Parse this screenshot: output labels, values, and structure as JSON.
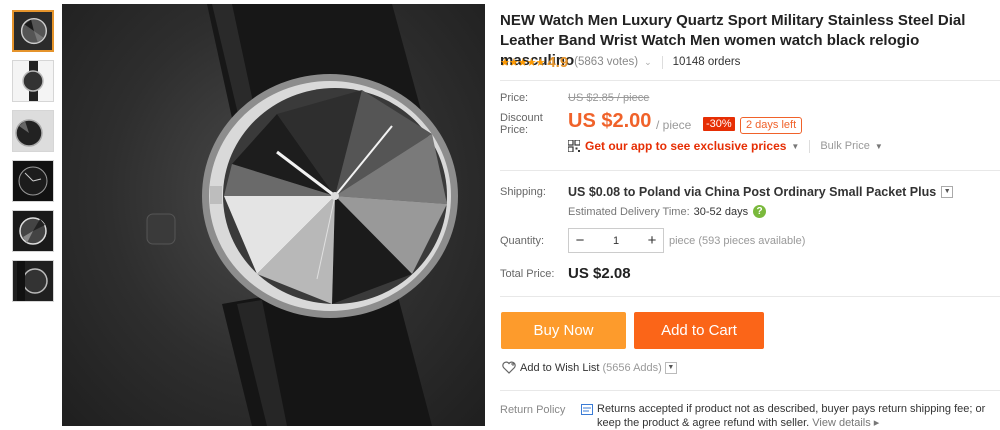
{
  "product": {
    "title": "NEW Watch Men Luxury Quartz Sport Military Stainless Steel Dial Leather Band Wrist Watch Men women watch black relogio masculino"
  },
  "gallery": {
    "thumbnail_count": 6,
    "active_index": 0
  },
  "rating": {
    "stars": "★★★★★",
    "value": "4.9",
    "votes": "(5863 votes)",
    "orders": "10148 orders"
  },
  "pricing": {
    "price_label": "Price:",
    "original_price": "US $2.85 / piece",
    "discount_label": "Discount Price:",
    "discount_price": "US $2.00",
    "per_piece": "/ piece",
    "discount_percent": "-30%",
    "days_left": "2 days left",
    "app_promo": "Get our app to see exclusive prices",
    "bulk_price": "Bulk Price"
  },
  "shipping": {
    "label": "Shipping:",
    "text": "US $0.08 to Poland via China Post Ordinary Small Packet Plus",
    "delivery_label": "Estimated Delivery Time:",
    "delivery_days": "30-52 days"
  },
  "quantity": {
    "label": "Quantity:",
    "minus": "−",
    "value": "1",
    "plus": "+",
    "note": "piece (593 pieces available)"
  },
  "total": {
    "label": "Total Price:",
    "value": "US $2.08"
  },
  "actions": {
    "buy_now": "Buy Now",
    "add_to_cart": "Add to Cart",
    "wish_list": "Add to Wish List",
    "wish_count": "(5656 Adds)"
  },
  "return_policy": {
    "label": "Return Policy",
    "text": "Returns accepted if product not as described, buyer pays return shipping fee; or keep the product & agree refund with seller.",
    "view_details": "View details ▸"
  },
  "colors": {
    "accent_orange": "#fd9b2c",
    "cart_orange": "#fb6518",
    "price_red": "#f0622a",
    "discount_red": "#e62e04",
    "help_green": "#7ab93c"
  }
}
